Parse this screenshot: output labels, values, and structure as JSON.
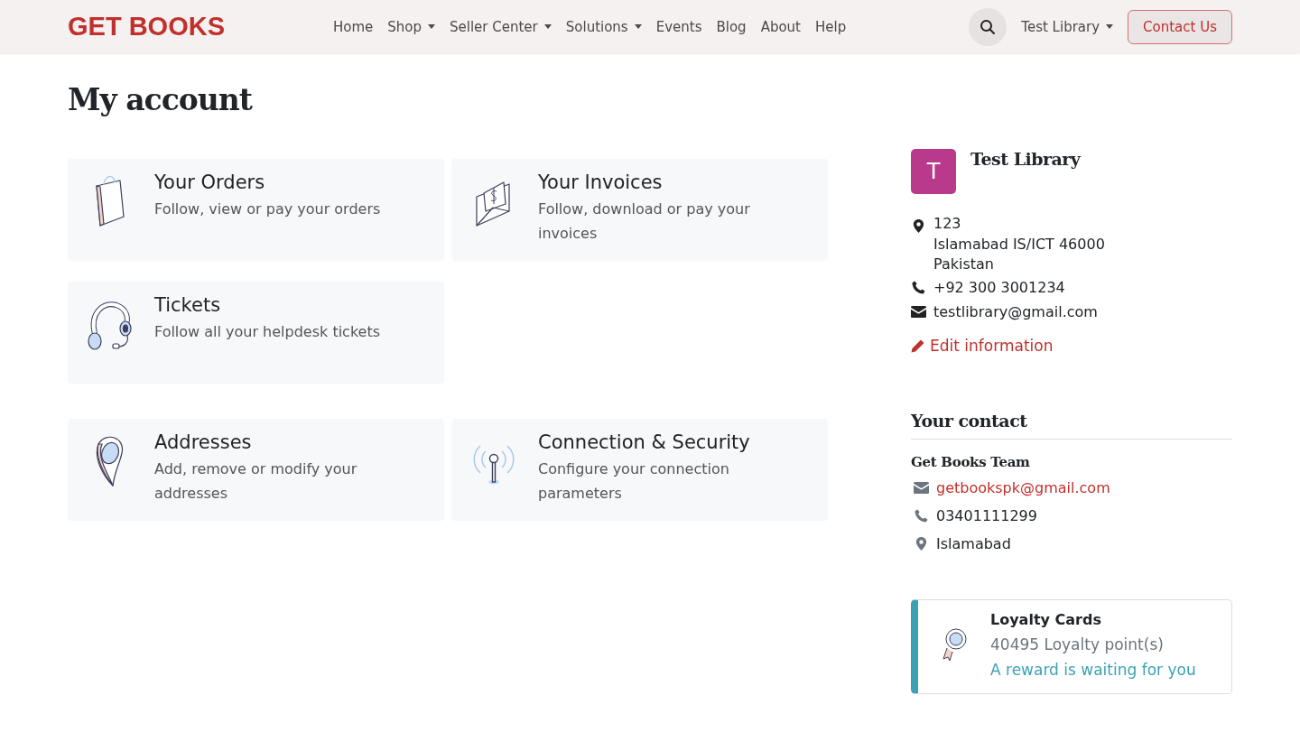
{
  "navbar": {
    "brand": "GET BOOKS",
    "items": [
      {
        "label": "Home",
        "dropdown": false
      },
      {
        "label": "Shop",
        "dropdown": true
      },
      {
        "label": "Seller Center",
        "dropdown": true
      },
      {
        "label": "Solutions",
        "dropdown": true
      },
      {
        "label": "Events",
        "dropdown": false
      },
      {
        "label": "Blog",
        "dropdown": false
      },
      {
        "label": "About",
        "dropdown": false
      },
      {
        "label": "Help",
        "dropdown": false
      }
    ],
    "user": {
      "label": "Test Library",
      "dropdown": true
    },
    "cta": "Contact Us"
  },
  "page_title": "My account",
  "card_groups": [
    [
      {
        "kind": "bag",
        "title": "Your Orders",
        "text": "Follow, view or pay your orders"
      },
      {
        "kind": "invoice",
        "title": "Your Invoices",
        "text": "Follow, download or pay your invoices"
      },
      {
        "kind": "headset",
        "title": "Tickets",
        "text": "Follow all your helpdesk tickets"
      }
    ],
    [
      {
        "kind": "pin",
        "title": "Addresses",
        "text": "Add, remove or modify your addresses"
      },
      {
        "kind": "antenna",
        "title": "Connection & Security",
        "text": "Configure your connection parameters"
      }
    ]
  ],
  "profile": {
    "initial": "T",
    "name": "Test Library",
    "address": [
      "123",
      "Islamabad IS/ICT 46000",
      "Pakistan"
    ],
    "phone": "+92 300 3001234",
    "email": "testlibrary@gmail.com",
    "edit": "Edit information"
  },
  "contact": {
    "heading": "Your contact",
    "team": "Get Books Team",
    "email": "getbookspk@gmail.com",
    "phone": "03401111299",
    "city": "Islamabad"
  },
  "loyalty": {
    "title": "Loyalty Cards",
    "points": "40495 Loyalty point(s)",
    "reward": "A reward is waiting for you"
  }
}
